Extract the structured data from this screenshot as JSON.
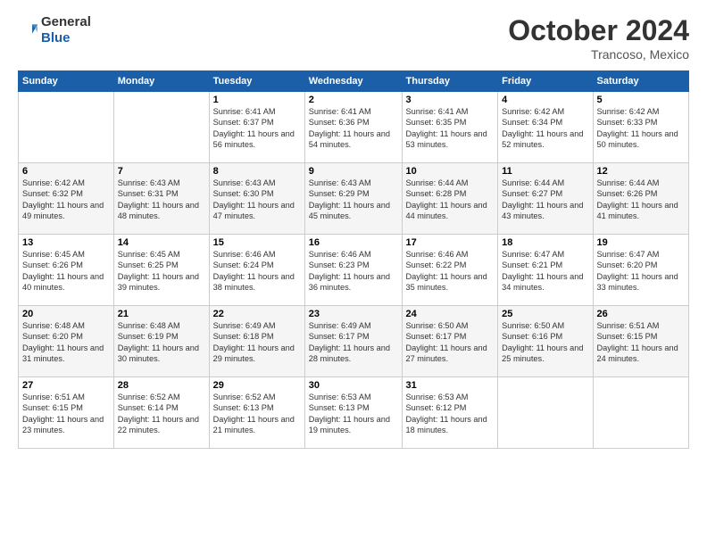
{
  "header": {
    "logo_general": "General",
    "logo_blue": "Blue",
    "month_title": "October 2024",
    "location": "Trancoso, Mexico"
  },
  "weekdays": [
    "Sunday",
    "Monday",
    "Tuesday",
    "Wednesday",
    "Thursday",
    "Friday",
    "Saturday"
  ],
  "weeks": [
    [
      {
        "day": "",
        "info": ""
      },
      {
        "day": "",
        "info": ""
      },
      {
        "day": "1",
        "info": "Sunrise: 6:41 AM\nSunset: 6:37 PM\nDaylight: 11 hours and 56 minutes."
      },
      {
        "day": "2",
        "info": "Sunrise: 6:41 AM\nSunset: 6:36 PM\nDaylight: 11 hours and 54 minutes."
      },
      {
        "day": "3",
        "info": "Sunrise: 6:41 AM\nSunset: 6:35 PM\nDaylight: 11 hours and 53 minutes."
      },
      {
        "day": "4",
        "info": "Sunrise: 6:42 AM\nSunset: 6:34 PM\nDaylight: 11 hours and 52 minutes."
      },
      {
        "day": "5",
        "info": "Sunrise: 6:42 AM\nSunset: 6:33 PM\nDaylight: 11 hours and 50 minutes."
      }
    ],
    [
      {
        "day": "6",
        "info": "Sunrise: 6:42 AM\nSunset: 6:32 PM\nDaylight: 11 hours and 49 minutes."
      },
      {
        "day": "7",
        "info": "Sunrise: 6:43 AM\nSunset: 6:31 PM\nDaylight: 11 hours and 48 minutes."
      },
      {
        "day": "8",
        "info": "Sunrise: 6:43 AM\nSunset: 6:30 PM\nDaylight: 11 hours and 47 minutes."
      },
      {
        "day": "9",
        "info": "Sunrise: 6:43 AM\nSunset: 6:29 PM\nDaylight: 11 hours and 45 minutes."
      },
      {
        "day": "10",
        "info": "Sunrise: 6:44 AM\nSunset: 6:28 PM\nDaylight: 11 hours and 44 minutes."
      },
      {
        "day": "11",
        "info": "Sunrise: 6:44 AM\nSunset: 6:27 PM\nDaylight: 11 hours and 43 minutes."
      },
      {
        "day": "12",
        "info": "Sunrise: 6:44 AM\nSunset: 6:26 PM\nDaylight: 11 hours and 41 minutes."
      }
    ],
    [
      {
        "day": "13",
        "info": "Sunrise: 6:45 AM\nSunset: 6:26 PM\nDaylight: 11 hours and 40 minutes."
      },
      {
        "day": "14",
        "info": "Sunrise: 6:45 AM\nSunset: 6:25 PM\nDaylight: 11 hours and 39 minutes."
      },
      {
        "day": "15",
        "info": "Sunrise: 6:46 AM\nSunset: 6:24 PM\nDaylight: 11 hours and 38 minutes."
      },
      {
        "day": "16",
        "info": "Sunrise: 6:46 AM\nSunset: 6:23 PM\nDaylight: 11 hours and 36 minutes."
      },
      {
        "day": "17",
        "info": "Sunrise: 6:46 AM\nSunset: 6:22 PM\nDaylight: 11 hours and 35 minutes."
      },
      {
        "day": "18",
        "info": "Sunrise: 6:47 AM\nSunset: 6:21 PM\nDaylight: 11 hours and 34 minutes."
      },
      {
        "day": "19",
        "info": "Sunrise: 6:47 AM\nSunset: 6:20 PM\nDaylight: 11 hours and 33 minutes."
      }
    ],
    [
      {
        "day": "20",
        "info": "Sunrise: 6:48 AM\nSunset: 6:20 PM\nDaylight: 11 hours and 31 minutes."
      },
      {
        "day": "21",
        "info": "Sunrise: 6:48 AM\nSunset: 6:19 PM\nDaylight: 11 hours and 30 minutes."
      },
      {
        "day": "22",
        "info": "Sunrise: 6:49 AM\nSunset: 6:18 PM\nDaylight: 11 hours and 29 minutes."
      },
      {
        "day": "23",
        "info": "Sunrise: 6:49 AM\nSunset: 6:17 PM\nDaylight: 11 hours and 28 minutes."
      },
      {
        "day": "24",
        "info": "Sunrise: 6:50 AM\nSunset: 6:17 PM\nDaylight: 11 hours and 27 minutes."
      },
      {
        "day": "25",
        "info": "Sunrise: 6:50 AM\nSunset: 6:16 PM\nDaylight: 11 hours and 25 minutes."
      },
      {
        "day": "26",
        "info": "Sunrise: 6:51 AM\nSunset: 6:15 PM\nDaylight: 11 hours and 24 minutes."
      }
    ],
    [
      {
        "day": "27",
        "info": "Sunrise: 6:51 AM\nSunset: 6:15 PM\nDaylight: 11 hours and 23 minutes."
      },
      {
        "day": "28",
        "info": "Sunrise: 6:52 AM\nSunset: 6:14 PM\nDaylight: 11 hours and 22 minutes."
      },
      {
        "day": "29",
        "info": "Sunrise: 6:52 AM\nSunset: 6:13 PM\nDaylight: 11 hours and 21 minutes."
      },
      {
        "day": "30",
        "info": "Sunrise: 6:53 AM\nSunset: 6:13 PM\nDaylight: 11 hours and 19 minutes."
      },
      {
        "day": "31",
        "info": "Sunrise: 6:53 AM\nSunset: 6:12 PM\nDaylight: 11 hours and 18 minutes."
      },
      {
        "day": "",
        "info": ""
      },
      {
        "day": "",
        "info": ""
      }
    ]
  ]
}
